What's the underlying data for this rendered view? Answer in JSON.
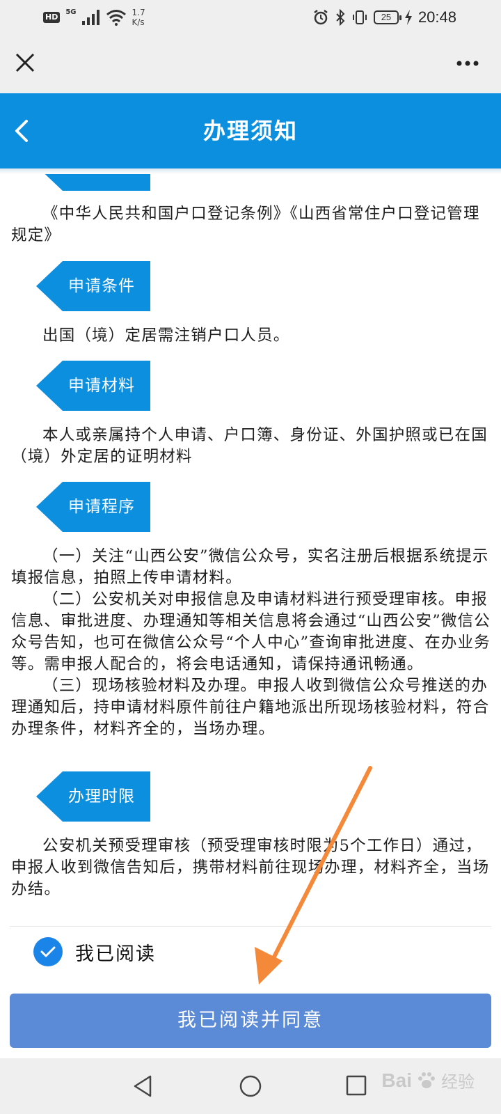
{
  "status_bar": {
    "hd": "HD",
    "network": "5G",
    "speed_value": "1.7",
    "speed_unit": "K/s",
    "battery": "25",
    "time": "20:48"
  },
  "header": {
    "title": "办理须知"
  },
  "sections": [
    {
      "tag": "",
      "text": [
        "《中华人民共和国户口登记条例》《山西省常住户口登记管理规定》"
      ]
    },
    {
      "tag": "申请条件",
      "text": [
        "出国（境）定居需注销户口人员。"
      ]
    },
    {
      "tag": "申请材料",
      "text": [
        "本人或亲属持个人申请、户口簿、身份证、外国护照或已在国（境）外定居的证明材料"
      ]
    },
    {
      "tag": "申请程序",
      "text": [
        "（一）关注“山西公安”微信公众号，实名注册后根据系统提示填报信息，拍照上传申请材料。",
        "（二）公安机关对申报信息及申请材料进行预受理审核。申报信息、审批进度、办理通知等相关信息将会通过“山西公安”微信公众号告知，也可在微信公众号“个人中心”查询审批进度、在办业务等。需申报人配合的，将会电话通知，请保持通讯畅通。",
        "（三）现场核验材料及办理。申报人收到微信公众号推送的办理通知后，持申请材料原件前往户籍地派出所现场核验材料，符合办理条件，材料齐全的，当场办理。"
      ]
    },
    {
      "tag": "办理时限",
      "text": [
        "公安机关预受理审核（预受理审核时限为5个工作日）通过，申报人收到微信告知后，携带材料前往现场办理，材料齐全，当场办结。"
      ]
    }
  ],
  "agree": {
    "label": "我已阅读",
    "checked": true
  },
  "confirm_button": "我已阅读并同意",
  "watermark": {
    "brand": "Bai",
    "sub": "经验"
  },
  "colors": {
    "header_blue": "#0d8fe0",
    "button_blue": "#5b8ad6",
    "check_blue": "#1a84e8",
    "annotation_arrow": "#f5893a"
  }
}
